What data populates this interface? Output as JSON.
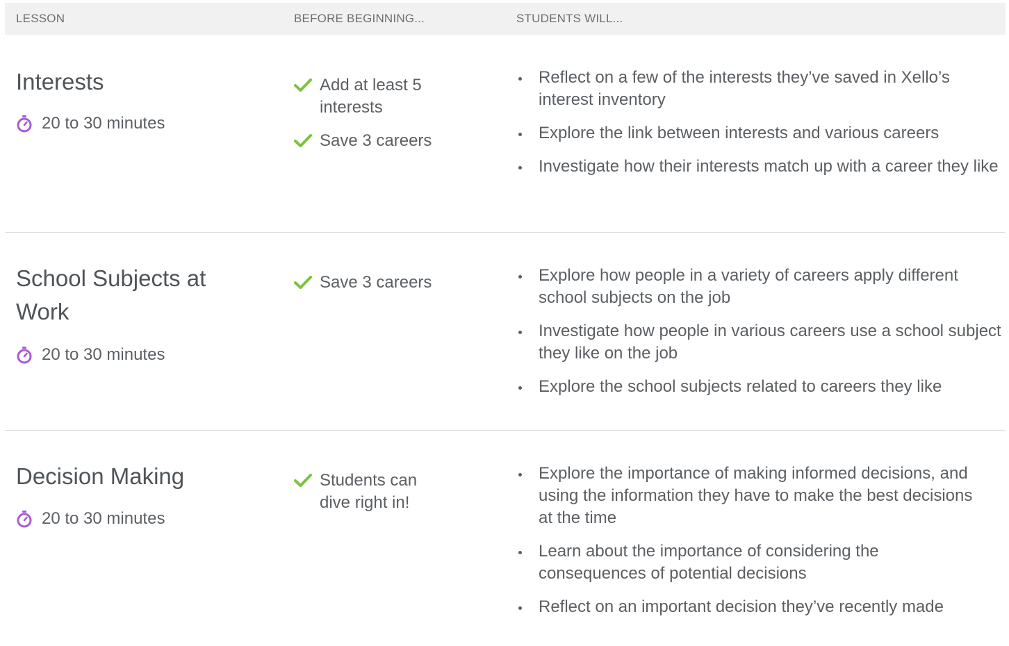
{
  "header": {
    "lesson": "LESSON",
    "before": "BEFORE BEGINNING...",
    "students": "STUDENTS WILL..."
  },
  "icons": {
    "timer": "stopwatch-icon",
    "check": "checkmark-icon"
  },
  "colors": {
    "accent_timer": "#a85ad6",
    "accent_check": "#7cc241",
    "header_bg": "#f1f1f1"
  },
  "lessons": [
    {
      "title": "Interests",
      "duration": "20 to 30 minutes",
      "prereqs": [
        "Add at least 5 interests",
        "Save 3 careers"
      ],
      "outcomes": [
        "Reflect on a few of the interests they’ve saved in Xello’s interest inventory",
        "Explore the link between interests and various careers",
        "Investigate how their interests match up with a career they like"
      ]
    },
    {
      "title": "School Subjects at Work",
      "duration": "20 to 30 minutes",
      "prereqs": [
        "Save 3 careers"
      ],
      "outcomes": [
        "Explore how people in a variety of careers apply different school subjects on the job",
        "Investigate how people in various careers use a school subject they like on the job",
        "Explore the school subjects related to careers they like"
      ]
    },
    {
      "title": "Decision Making",
      "duration": "20 to 30 minutes",
      "prereqs": [
        "Students can dive right in!"
      ],
      "outcomes": [
        "Explore the importance of making informed decisions, and using the information they have to make the best decisions at the time",
        "Learn about the importance of considering the consequences of potential decisions",
        "Reflect on an important decision they’ve recently made"
      ]
    }
  ]
}
